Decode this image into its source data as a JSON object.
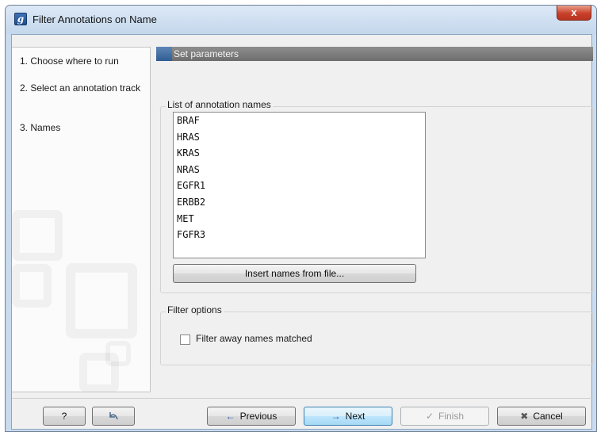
{
  "window": {
    "title": "Filter Annotations on Name",
    "app_icon_letter": "g",
    "close_label": "x"
  },
  "steps": [
    {
      "label": "1. Choose where to run"
    },
    {
      "label": "2. Select an annotation track"
    },
    {
      "label": "3. Names"
    }
  ],
  "panel_header": "Set parameters",
  "names_group": {
    "legend": "List of annotation names",
    "items": [
      "BRAF",
      "HRAS",
      "KRAS",
      "NRAS",
      "EGFR1",
      "ERBB2",
      "MET",
      "FGFR3"
    ],
    "insert_button": "Insert names from file..."
  },
  "filter_group": {
    "legend": "Filter options",
    "checkbox_label": "Filter away names matched",
    "checkbox_checked": false
  },
  "footer": {
    "help_label": "?",
    "reset_icon": "undo-arrow-icon",
    "previous_label": "Previous",
    "next_label": "Next",
    "finish_label": "Finish",
    "cancel_label": "Cancel"
  },
  "colors": {
    "header_bg": "#7e7e7e",
    "focus_border": "#3c7fb1"
  }
}
